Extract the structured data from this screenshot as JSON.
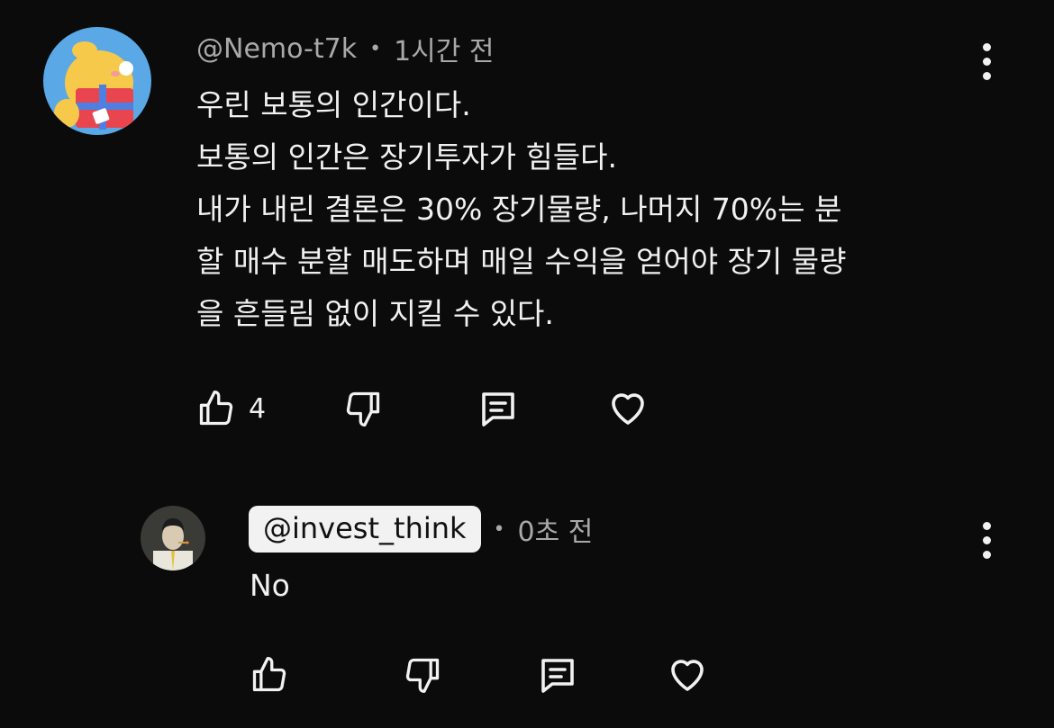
{
  "comment": {
    "author": "@Nemo-t7k",
    "time": "1시간 전",
    "body": "우린 보통의 인간이다.\n보통의 인간은 장기투자가 힘들다.\n내가 내린 결론은 30% 장기물량, 나머지 70%는 분\n할 매수 분할 매도하며 매일 수익을 얻어야 장기 물량\n을 흔들림 없이 지킬 수 있다.",
    "like_count": "4"
  },
  "reply": {
    "author": "@invest_think",
    "time": "0초 전",
    "body": "No"
  },
  "separator": "•",
  "icons": {
    "like": "thumbs-up-icon",
    "dislike": "thumbs-down-icon",
    "reply": "comment-icon",
    "heart": "heart-icon",
    "more": "more-vertical-icon"
  },
  "colors": {
    "background": "#0b0b0b",
    "text": "#f1f1f1",
    "meta": "#a9a9a9",
    "chip": "#f2f2f2"
  }
}
